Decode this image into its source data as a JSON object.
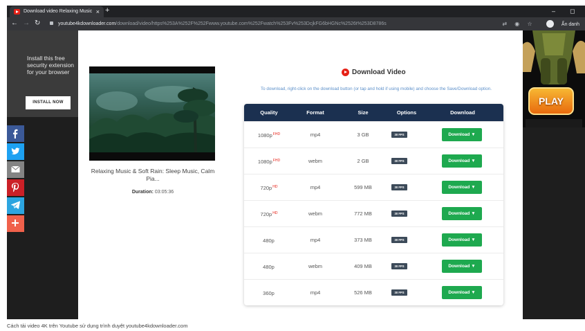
{
  "browser": {
    "tab_title": "Download video Relaxing Music",
    "tab_close": "×",
    "new_tab": "+",
    "minimize": "–",
    "restore": "◻",
    "url_host": "youtube4kdownloader.com",
    "url_path": "/download/video/https%253A%252F%252Fwww.youtube.com%252Fwatch%253Fv%253DcjkFG6bHGNc%2526t%253D8786s",
    "profile_label": "Ẩn danh"
  },
  "left_ad": {
    "text": "Install this free security extension for your browser",
    "button": "INSTALL NOW"
  },
  "video": {
    "title": "Relaxing Music & Soft Rain: Sleep Music, Calm Pia...",
    "duration_label": "Duration:",
    "duration_value": "03:05:36"
  },
  "download": {
    "heading": "Download Video",
    "instructions": "To download, right-click on the download button (or tap and hold if using mobile) and choose the Save/Download option."
  },
  "table": {
    "headers": [
      "Quality",
      "Format",
      "Size",
      "Options",
      "Download"
    ],
    "rows": [
      {
        "quality": "1080p",
        "badge": "FHD",
        "format": "mp4",
        "size": "3 GB",
        "fps": "30 FPS",
        "button": "Download ▼"
      },
      {
        "quality": "1080p",
        "badge": "FHD",
        "format": "webm",
        "size": "2 GB",
        "fps": "30 FPS",
        "button": "Download ▼"
      },
      {
        "quality": "720p",
        "badge": "HD",
        "format": "mp4",
        "size": "599 MB",
        "fps": "30 FPS",
        "button": "Download ▼"
      },
      {
        "quality": "720p",
        "badge": "HD",
        "format": "webm",
        "size": "772 MB",
        "fps": "30 FPS",
        "button": "Download ▼"
      },
      {
        "quality": "480p",
        "badge": "",
        "format": "mp4",
        "size": "373 MB",
        "fps": "30 FPS",
        "button": "Download ▼"
      },
      {
        "quality": "480p",
        "badge": "",
        "format": "webm",
        "size": "409 MB",
        "fps": "30 FPS",
        "button": "Download ▼"
      },
      {
        "quality": "360p",
        "badge": "",
        "format": "mp4",
        "size": "526 MB",
        "fps": "30 FPS",
        "button": "Download ▼"
      }
    ]
  },
  "right_ad": {
    "button": "PLAY"
  },
  "share_icons": [
    "facebook-icon",
    "twitter-icon",
    "email-icon",
    "pinterest-icon",
    "telegram-icon",
    "plus-icon"
  ],
  "share_colors": [
    "#3b5998",
    "#1da1f2",
    "#848484",
    "#cb2027",
    "#2ca5e0",
    "#f0614b"
  ],
  "caption": "Cách tải video 4K trên Youtube sử dụng trình duyệt youtube4kdownloader.com"
}
